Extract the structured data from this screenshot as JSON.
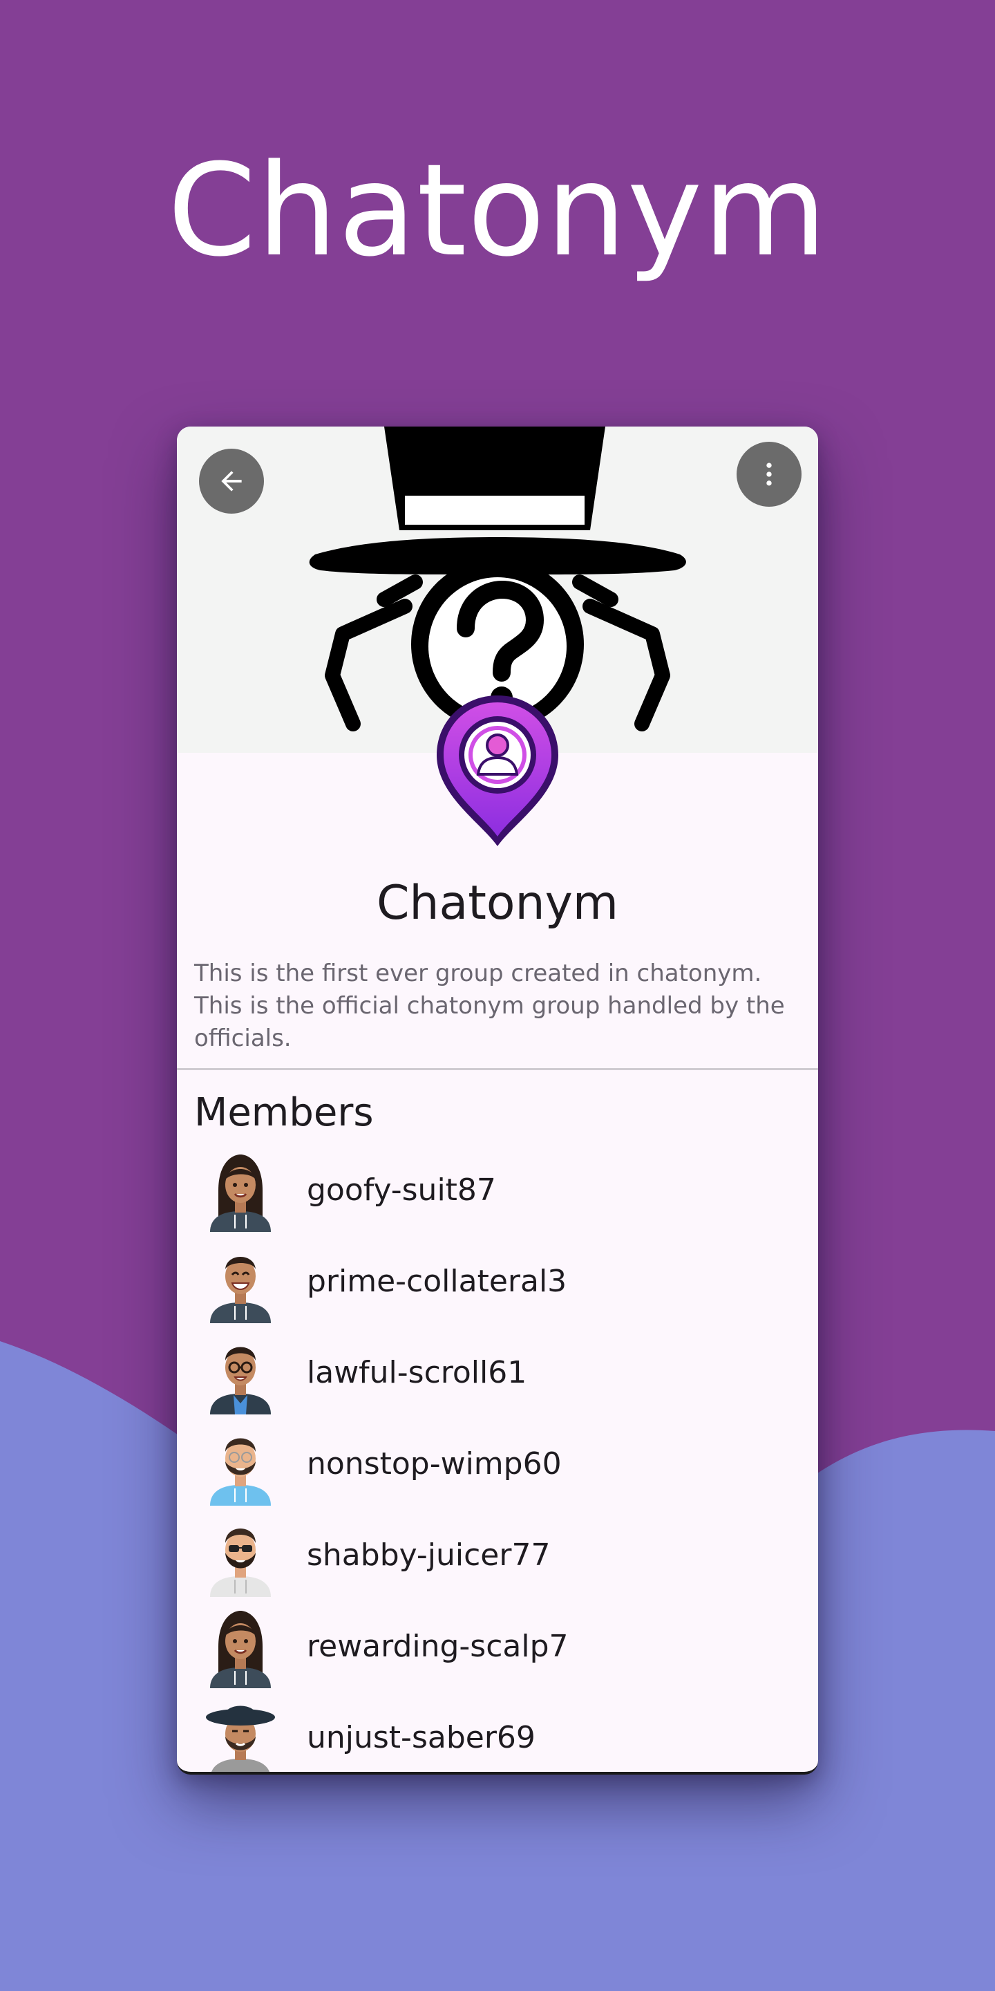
{
  "promo": {
    "title": "Chatonym"
  },
  "colors": {
    "background_top": "#843f95",
    "background_wave": "#7f86d7",
    "card_background": "#fdf7fd",
    "button_background": "#6b6b6b",
    "logo_pin": "#b040e0"
  },
  "screen": {
    "back_button_icon": "arrow-back-icon",
    "menu_button_icon": "more-vert-icon",
    "cover_image": "spy-hat-question-mark-illustration",
    "group_logo": "purple-map-pin-user-icon",
    "group": {
      "name": "Chatonym",
      "description": "This is the first ever group created in chatonym. This is the official chatonym group handled by the officials."
    },
    "members_heading": "Members",
    "members": [
      {
        "name": "goofy-suit87",
        "avatar": "woman-long-hair-avatar"
      },
      {
        "name": "prime-collateral3",
        "avatar": "man-laughing-avatar"
      },
      {
        "name": "lawful-scroll61",
        "avatar": "man-glasses-avatar"
      },
      {
        "name": "nonstop-wimp60",
        "avatar": "man-beard-glasses-avatar"
      },
      {
        "name": "shabby-juicer77",
        "avatar": "man-sunglasses-beard-avatar"
      },
      {
        "name": "rewarding-scalp7",
        "avatar": "woman-long-hair-avatar"
      },
      {
        "name": "unjust-saber69",
        "avatar": "man-hat-beard-avatar"
      }
    ]
  }
}
